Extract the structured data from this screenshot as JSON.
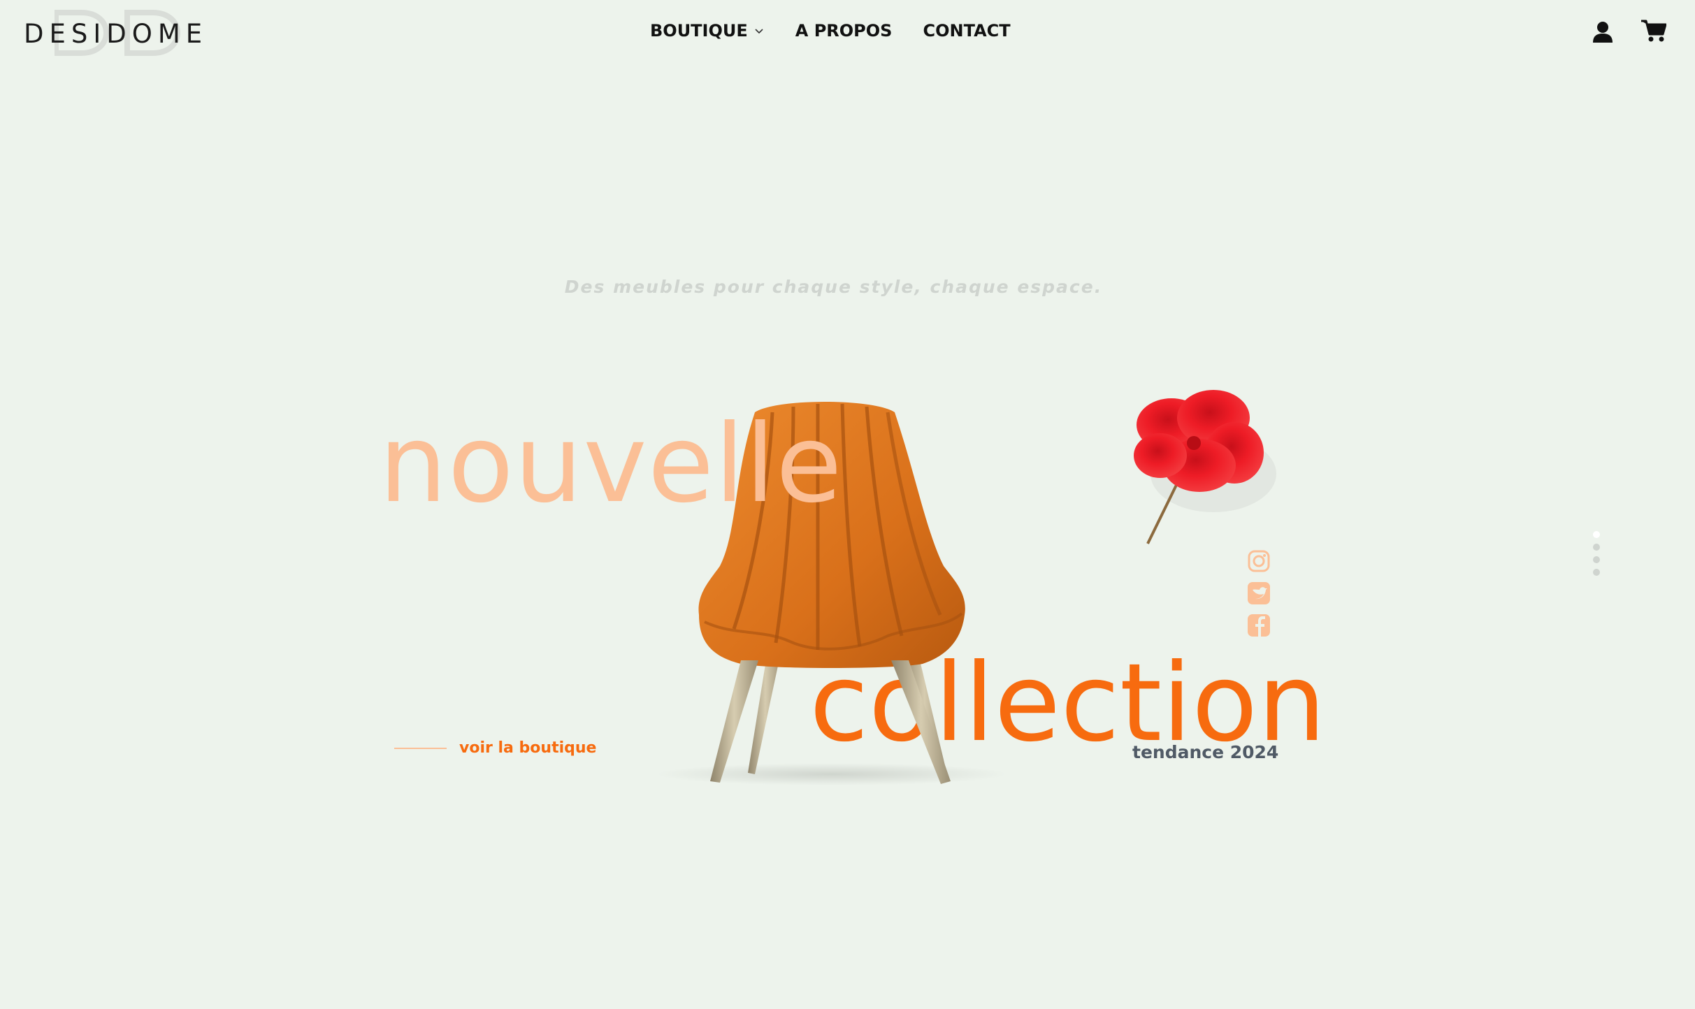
{
  "header": {
    "logo_text": "DESIDOME",
    "nav": [
      {
        "label": "BOUTIQUE",
        "has_dropdown": true
      },
      {
        "label": "A PROPOS",
        "has_dropdown": false
      },
      {
        "label": "CONTACT",
        "has_dropdown": false
      }
    ],
    "icons": {
      "account": "user-icon",
      "cart": "cart-icon"
    }
  },
  "hero": {
    "tagline": "Des meubles pour chaque style, chaque espace.",
    "word_top": "nouvelle",
    "word_bottom": "collection",
    "subtitle": "tendance 2024",
    "cta_label": "voir la boutique",
    "social": [
      "instagram-icon",
      "twitter-icon",
      "facebook-icon"
    ],
    "slides": {
      "count": 4,
      "active": 1
    }
  },
  "colors": {
    "background": "#edf3ec",
    "accent": "#f76b0f",
    "accent_light": "#fbbf96",
    "subtitle": "#505a66",
    "tagline": "#cfd4cf",
    "chair": "#e0751a",
    "flower": "#ee1c26"
  }
}
